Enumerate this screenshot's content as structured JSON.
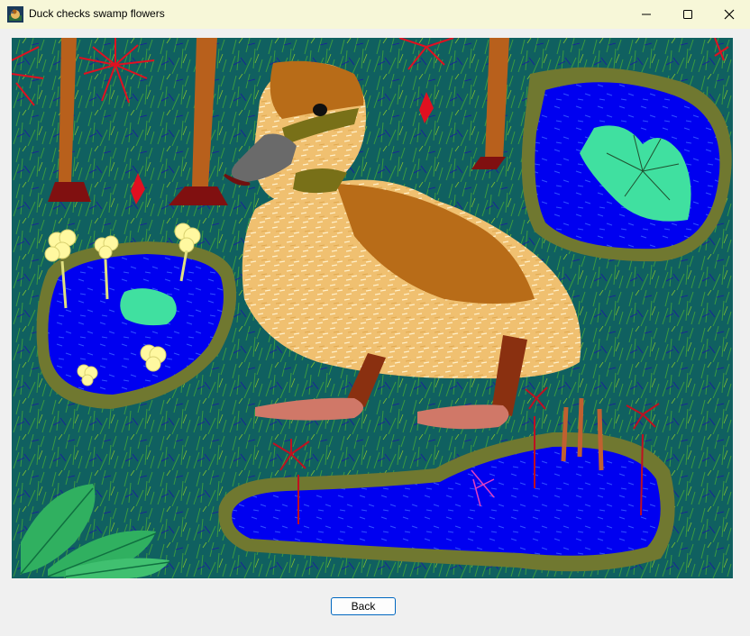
{
  "window": {
    "title": "Duck checks swamp flowers"
  },
  "title_icon": "duck-icon",
  "controls": {
    "minimize_icon": "minimize-icon",
    "maximize_icon": "maximize-icon",
    "close_icon": "close-icon"
  },
  "buttons": {
    "back_label": "Back"
  },
  "colors": {
    "titlebar": "#f7f7d8",
    "swamp": "#106060",
    "water": "#0000ff",
    "lily_pad": "#40e0a0",
    "duck_body": "#f0c070",
    "duck_brown": "#b86c18",
    "flowers_red": "#e01020",
    "accent_border": "#0067c0"
  }
}
